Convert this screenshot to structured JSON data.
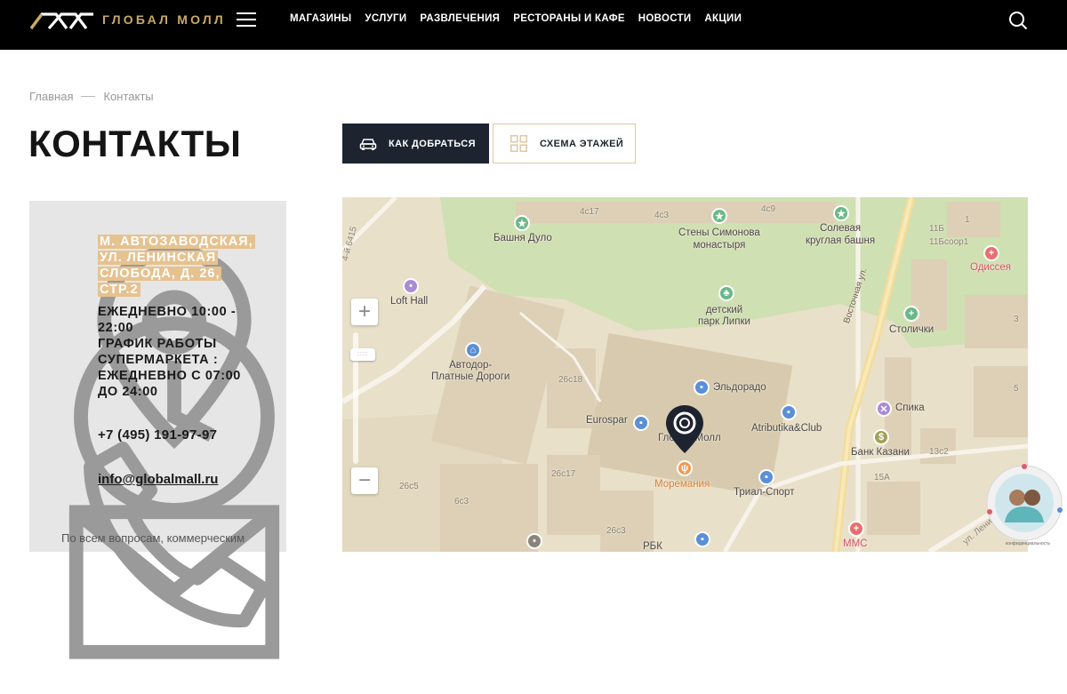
{
  "header": {
    "brand": "ГЛОБАЛ МОЛЛ",
    "nav": [
      "МАГАЗИНЫ",
      "УСЛУГИ",
      "РАЗВЛЕЧЕНИЯ",
      "РЕСТОРАНЫ И КАФЕ",
      "НОВОСТИ",
      "АКЦИИ"
    ]
  },
  "breadcrumb": {
    "home": "Главная",
    "current": "Контакты"
  },
  "page_title": "КОНТАКТЫ",
  "buttons": {
    "route": "КАК ДОБРАТЬСЯ",
    "scheme": "СХЕМА ЭТАЖЕЙ"
  },
  "contacts": {
    "address": "М. АВТОЗАВОДСКАЯ, УЛ. ЛЕНИНСКАЯ СЛОБОДА, Д. 26, СТР.2",
    "hours": "ЕЖЕДНЕВНО 10:00 - 22:00\nГРАФИК РАБОТЫ СУПЕРМАРКЕТА : ЕЖЕДНЕВНО С 07:00 ДО 24:00",
    "phone": "+7 (495) 191-97-97",
    "email": "info@globalmall.ru",
    "footnote": "По всем вопросам, коммерческим"
  },
  "map": {
    "labels": {
      "bashnya": "Башня Дуло",
      "steny": "Стены Симонова\nмонастыря",
      "solevaya": "Солевая\nкруглая башня",
      "odisseya": "Одиссея",
      "lofthall": "Loft Hall",
      "park": "детский\nпарк Липки",
      "stolichki": "Столички",
      "avtodor": "Автодор-\nПлатные Дороги",
      "eldorado": "Эльдорадо",
      "spika": "Спика",
      "eurospar": "Eurospar",
      "globalmall": "Глобал Молл",
      "atributika": "Atributika&Club",
      "bankkazani": "Банк Казани",
      "moremaniya": "Моремания",
      "trialsport": "Триал-Спорт",
      "mms": "ММС",
      "rbk": "РБК",
      "street_vostochnaya": "Восточная ул.",
      "street_6415": "4-й 6415",
      "street_lenin": "ул. Ленин"
    },
    "buildings": [
      "4с17",
      "4с3",
      "4с9",
      "11Б",
      "11Бсоор1",
      "26с18",
      "26с17",
      "26с5",
      "26с3",
      "13с2",
      "15А",
      "6с3",
      "1",
      "3",
      "5"
    ],
    "colors": {
      "base": "#e9e0c9",
      "park": "#cfe0b2",
      "building": "#ddd0b7",
      "road": "#f7f3ea",
      "highway": "#f3dc9c",
      "marker": "#1d2430"
    }
  },
  "widget": {
    "caption": "конфиденциальность"
  }
}
